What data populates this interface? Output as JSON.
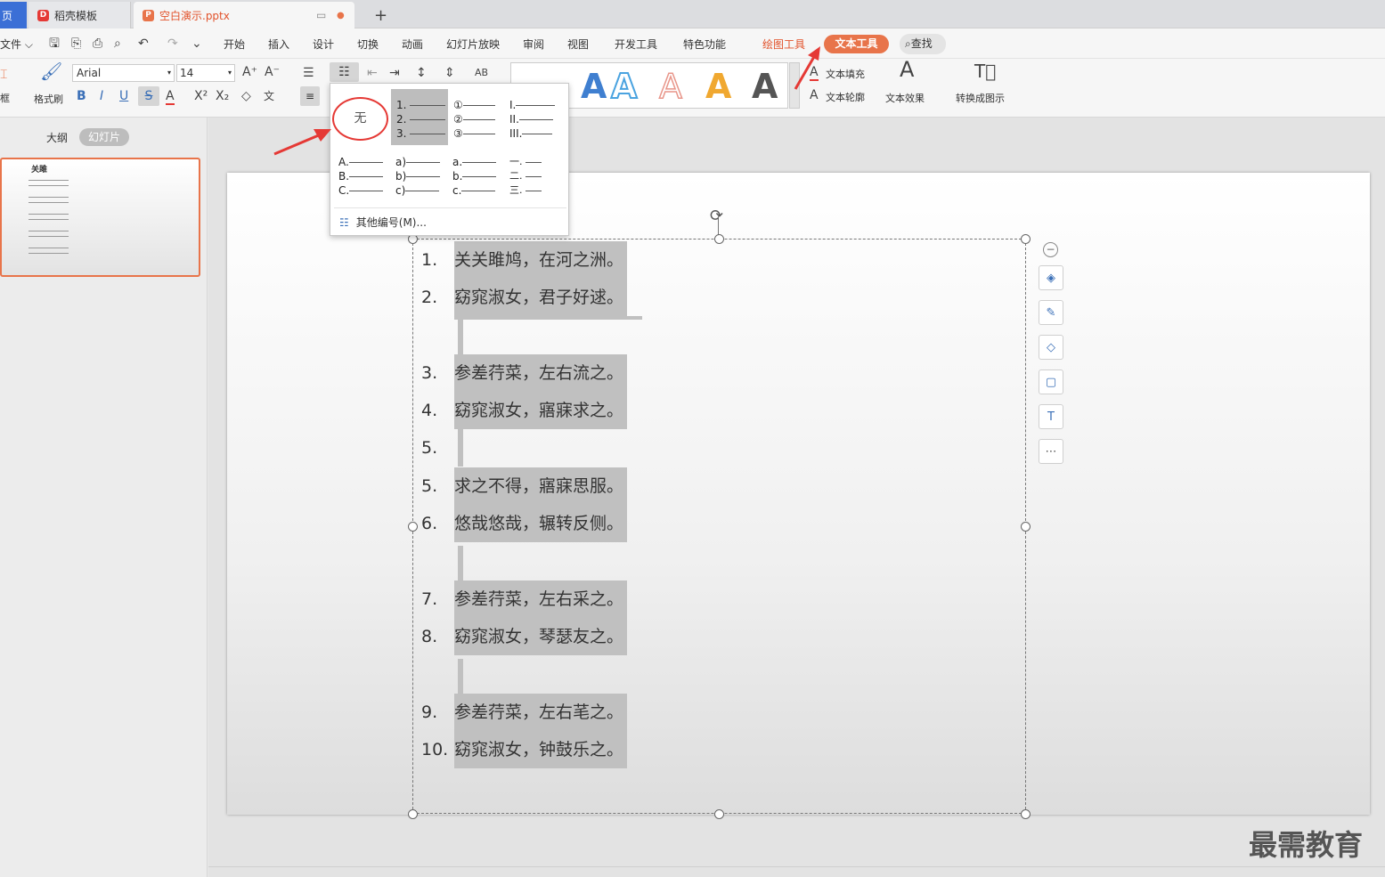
{
  "tabs": {
    "home": "页",
    "template": "稻壳模板",
    "file": "空白演示.pptx",
    "new": "+"
  },
  "menu": {
    "file": "文件",
    "items": [
      "开始",
      "插入",
      "设计",
      "切换",
      "动画",
      "幻灯片放映",
      "审阅",
      "视图",
      "开发工具",
      "特色功能"
    ],
    "draw_tools": "绘图工具",
    "text_tools": "文本工具",
    "search": "查找"
  },
  "ribbon": {
    "frame": "框",
    "format_painter": "格式刷",
    "font": "Arial",
    "size": "14",
    "text_fill": "文本填充",
    "text_outline": "文本轮廓",
    "text_effect": "文本效果",
    "convert": "转换成图示",
    "wordart_letter": "A"
  },
  "dropdown": {
    "none": "无",
    "styles": [
      [
        "1.",
        "2.",
        "3."
      ],
      [
        "①",
        "②",
        "③"
      ],
      [
        "I.",
        "II.",
        "III."
      ],
      [
        "A.",
        "B.",
        "C."
      ],
      [
        "a)",
        "b)",
        "c)"
      ],
      [
        "a.",
        "b.",
        "c."
      ],
      [
        "一.",
        "二.",
        "三."
      ]
    ],
    "more": "其他编号(M)..."
  },
  "panel": {
    "outline": "大纲",
    "slides": "幻灯片"
  },
  "thumb": {
    "title": "关雎"
  },
  "slide": {
    "lines": [
      {
        "n": "1.",
        "t": "关关雎鸠，在河之洲。"
      },
      {
        "n": "2.",
        "t": "窈窕淑女，君子好逑。"
      },
      {
        "n": "",
        "t": ""
      },
      {
        "n": "3.",
        "t": "参差荇菜，左右流之。"
      },
      {
        "n": "4.",
        "t": "窈窕淑女，寤寐求之。"
      },
      {
        "n": "5.",
        "t": ""
      },
      {
        "n": "5.",
        "t": "求之不得，寤寐思服。"
      },
      {
        "n": "6.",
        "t": "悠哉悠哉，辗转反侧。"
      },
      {
        "n": "",
        "t": ""
      },
      {
        "n": "7.",
        "t": "参差荇菜，左右采之。"
      },
      {
        "n": "8.",
        "t": "窈窕淑女，琴瑟友之。"
      },
      {
        "n": "",
        "t": ""
      },
      {
        "n": "9.",
        "t": "参差荇菜，左右芼之。"
      },
      {
        "n": "10.",
        "t": "窈窕淑女，钟鼓乐之。"
      }
    ]
  },
  "watermark": "最需教育",
  "colors": {
    "accent": "#e8744a",
    "red_circle": "#e53935",
    "selected": "#bdbdbd"
  }
}
